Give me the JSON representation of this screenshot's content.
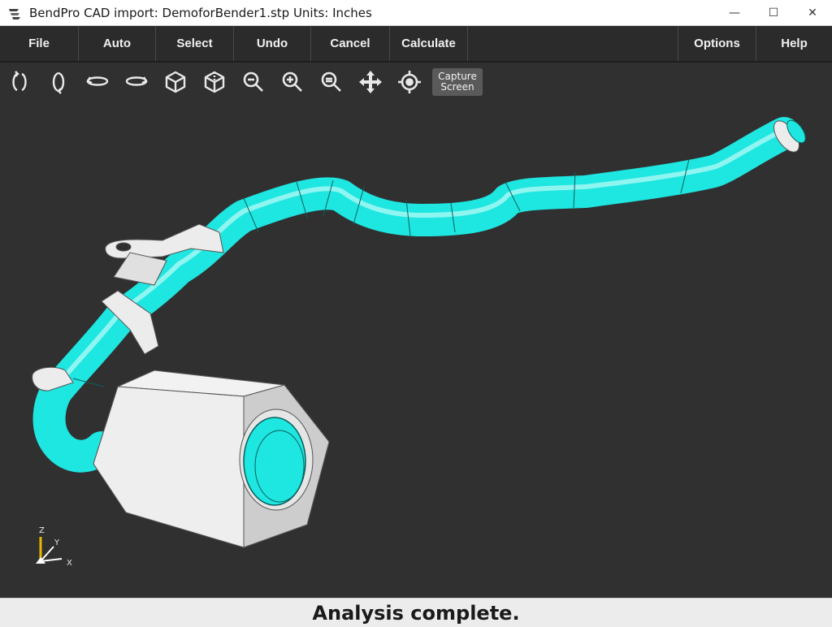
{
  "window": {
    "title": "BendPro CAD import: DemoforBender1.stp  Units: Inches",
    "minimize_glyph": "—",
    "maximize_glyph": "☐",
    "close_glyph": "✕"
  },
  "menu": {
    "left": [
      "File",
      "Auto",
      "Select",
      "Undo",
      "Cancel",
      "Calculate"
    ],
    "right": [
      "Options",
      "Help"
    ]
  },
  "toolbar": {
    "icons": [
      "rotate-x-icon",
      "rotate-y-icon",
      "rotate-left-icon",
      "rotate-right-icon",
      "iso-view-front-icon",
      "iso-view-back-icon",
      "zoom-out-icon",
      "zoom-in-icon",
      "zoom-fit-icon",
      "pan-icon",
      "center-view-icon"
    ],
    "capture_line1": "Capture",
    "capture_line2": "Screen"
  },
  "axes": {
    "z": "Z",
    "y": "Y",
    "x": "X"
  },
  "colors": {
    "tube": "#1ee6e0",
    "fitting": "#ececec",
    "background": "#303030"
  },
  "status": {
    "text": "Analysis complete."
  }
}
